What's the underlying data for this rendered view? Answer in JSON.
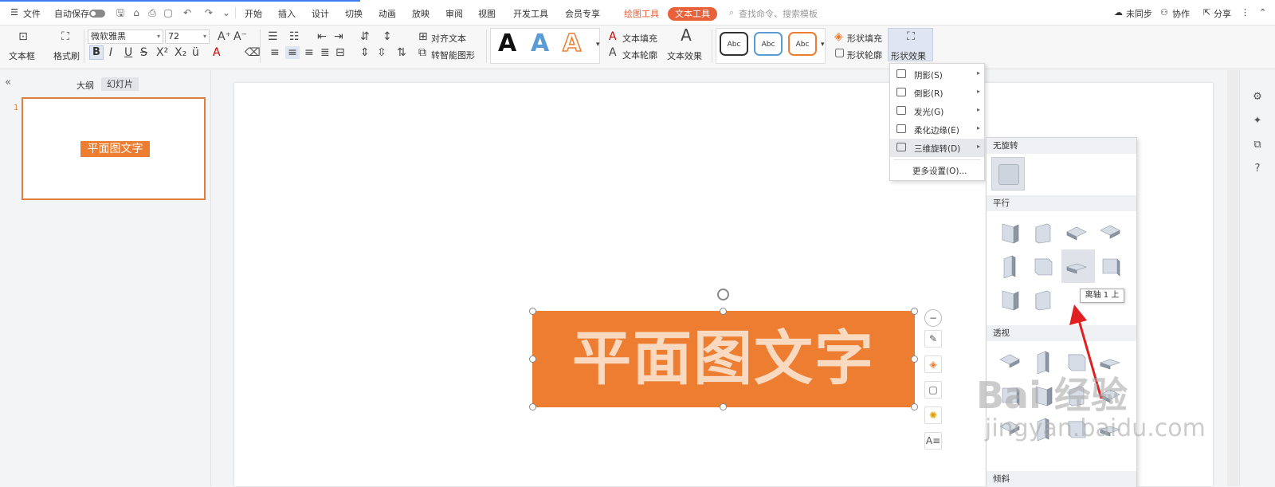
{
  "menubar": {
    "file": "文件",
    "autosave": "自动保存",
    "tabs": [
      "开始",
      "插入",
      "设计",
      "切换",
      "动画",
      "放映",
      "审阅",
      "视图",
      "开发工具",
      "会员专享"
    ],
    "draw_tools": "绘图工具",
    "text_tools": "文本工具",
    "search_placeholder": "查找命令、搜索模板",
    "unsynced": "未同步",
    "collaborate": "协作",
    "share": "分享"
  },
  "ribbon": {
    "textbox": "文本框",
    "format_painter": "格式刷",
    "font_name": "微软雅黑",
    "font_size": "72",
    "align_text": "对齐文本",
    "smart_shape": "转智能图形",
    "text_fill": "文本填充",
    "text_outline": "文本轮廓",
    "text_effects": "文本效果",
    "shape_fill": "形状填充",
    "shape_outline": "形状轮廓",
    "shape_effects": "形状效果",
    "abc_styles": [
      "Abc",
      "Abc",
      "Abc"
    ],
    "big_a_letters": [
      "A",
      "A",
      "A"
    ]
  },
  "leftpanel": {
    "tab_outline": "大纲",
    "tab_slides": "幻灯片",
    "slide_number": "1",
    "thumb_text": "平面图文字"
  },
  "canvas": {
    "textbox_text": "平面图文字"
  },
  "effects_menu": {
    "items": [
      {
        "label": "阴影(S)"
      },
      {
        "label": "倒影(R)"
      },
      {
        "label": "发光(G)"
      },
      {
        "label": "柔化边缘(E)"
      },
      {
        "label": "三维旋转(D)"
      }
    ],
    "more": "更多设置(O)..."
  },
  "sub_3d": {
    "no_rotation": "无旋转",
    "parallel": "平行",
    "perspective": "透视",
    "oblique": "倾斜"
  },
  "tooltip": "离轴 1 上",
  "watermark": {
    "logo": "Bai 经验",
    "url": "jingyan.baidu.com"
  },
  "colors": {
    "accent_orange": "#ed7d31",
    "tab_orange": "#e8613a",
    "arrow_red": "#e02020"
  }
}
